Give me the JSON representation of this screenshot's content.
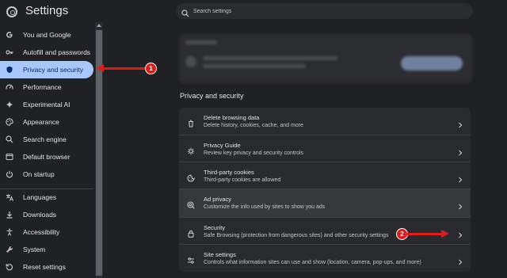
{
  "header": {
    "title": "Settings",
    "search_placeholder": "Search settings"
  },
  "sidebar": {
    "items": [
      {
        "label": "You and Google",
        "icon": "google-icon"
      },
      {
        "label": "Autofill and passwords",
        "icon": "key-icon"
      },
      {
        "label": "Privacy and security",
        "icon": "shield-icon",
        "active": true
      },
      {
        "label": "Performance",
        "icon": "speedometer-icon"
      },
      {
        "label": "Experimental AI",
        "icon": "sparkle-icon"
      },
      {
        "label": "Appearance",
        "icon": "palette-icon"
      },
      {
        "label": "Search engine",
        "icon": "search-icon"
      },
      {
        "label": "Default browser",
        "icon": "browser-icon"
      },
      {
        "label": "On startup",
        "icon": "power-icon"
      },
      {
        "label": "Languages",
        "icon": "translate-icon"
      },
      {
        "label": "Downloads",
        "icon": "download-icon"
      },
      {
        "label": "Accessibility",
        "icon": "accessibility-icon"
      },
      {
        "label": "System",
        "icon": "wrench-icon"
      },
      {
        "label": "Reset settings",
        "icon": "reset-icon"
      }
    ]
  },
  "main": {
    "section_title": "Privacy and security",
    "rows": [
      {
        "title": "Delete browsing data",
        "subtitle": "Delete history, cookies, cache, and more",
        "icon": "trash-icon"
      },
      {
        "title": "Privacy Guide",
        "subtitle": "Review key privacy and security controls",
        "icon": "privacy-guide-icon"
      },
      {
        "title": "Third-party cookies",
        "subtitle": "Third-party cookies are allowed",
        "icon": "cookie-icon"
      },
      {
        "title": "Ad privacy",
        "subtitle": "Customize the info used by sites to show you ads",
        "icon": "ad-privacy-icon",
        "hover": true
      },
      {
        "title": "Security",
        "subtitle": "Safe Browsing (protection from dangerous sites) and other security settings",
        "icon": "lock-icon"
      },
      {
        "title": "Site settings",
        "subtitle": "Controls what information sites can use and show (location, camera, pop-ups, and more)",
        "icon": "sliders-icon"
      }
    ]
  },
  "annotations": [
    {
      "number": "1",
      "target": "Privacy and security"
    },
    {
      "number": "2",
      "target": "Security"
    }
  ],
  "colors": {
    "accent": "#a8c7fa",
    "annotation": "#e01b1b",
    "background": "#202124",
    "card": "#292a2d"
  }
}
